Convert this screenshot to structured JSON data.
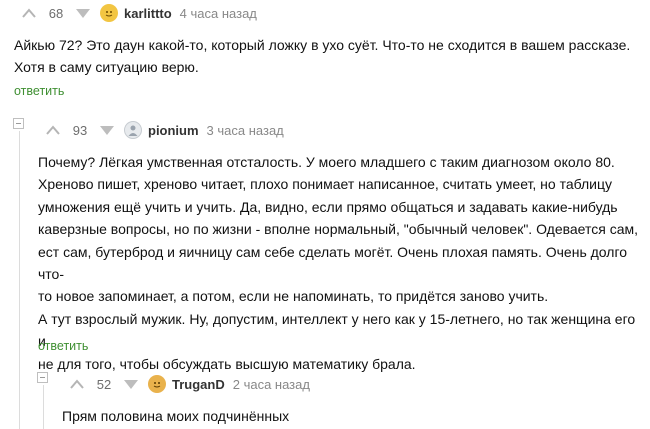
{
  "comments": [
    {
      "rating": "68",
      "username": "karlittto",
      "time": "4 часа назад",
      "text": "Айкью 72? Это даун какой-то, который ложку в ухо суёт. Что-то не сходится в вашем рассказе.\nХотя в саму ситуацию верю.",
      "reply_label": "ответить",
      "avatar_color": "#f2c542"
    },
    {
      "rating": "93",
      "username": "pionium",
      "time": "3 часа назад",
      "text": "Почему? Лёгкая умственная отсталость. У моего младшего с таким диагнозом около 80.\nХреново пишет, хреново читает, плохо понимает написанное, считать умеет, но таблицу\nумножения ещё учить и учить. Да, видно, если прямо общаться и задавать какие-нибудь\nкаверзные вопросы, но по жизни - вполне нормальный, \"обычный человек\". Одевается сам,\nест сам, бутерброд и яичницу сам себе сделать могёт. Очень плохая память. Очень долго что-\nто новое запоминает, а потом, если не напоминать, то придётся заново учить.\nА тут взрослый мужик. Ну, допустим, интеллект у него как у 15-летнего, но так женщина его и\nне для того, чтобы обсуждать высшую математику брала.",
      "reply_label": "ответить",
      "avatar_color": "#9aa3ad"
    },
    {
      "rating": "52",
      "username": "TruganD",
      "time": "2 часа назад",
      "text": "Прям половина моих подчинённых",
      "avatar_color": "#e9b24c"
    }
  ],
  "colors": {
    "reply": "#3f8f32",
    "meta": "#888888"
  }
}
